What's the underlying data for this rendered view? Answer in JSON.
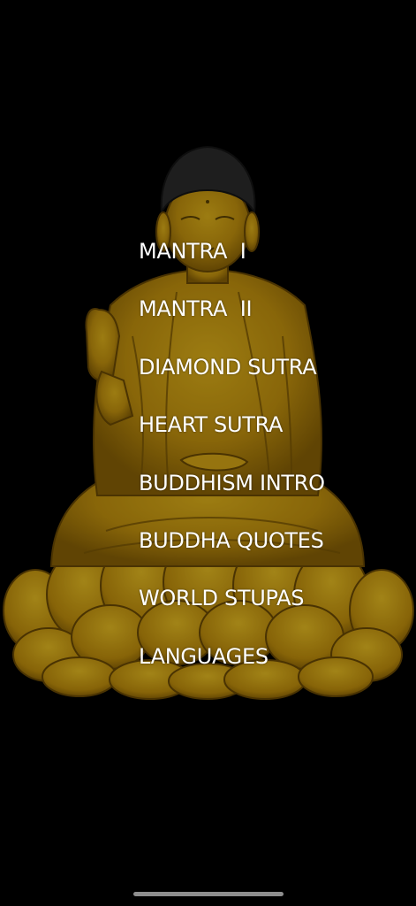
{
  "background": {
    "image": "seated-golden-buddha-on-lotus",
    "color": "#000000",
    "figure_color": "#c99a10",
    "hair_color": "#2b2b2b"
  },
  "menu": {
    "items": [
      {
        "label": "MANTRA  I"
      },
      {
        "label": "MANTRA  II"
      },
      {
        "label": "DIAMOND SUTRA"
      },
      {
        "label": "HEART SUTRA"
      },
      {
        "label": "BUDDHISM INTRO"
      },
      {
        "label": "BUDDHA QUOTES"
      },
      {
        "label": "WORLD STUPAS"
      },
      {
        "label": "LANGUAGES"
      }
    ]
  }
}
